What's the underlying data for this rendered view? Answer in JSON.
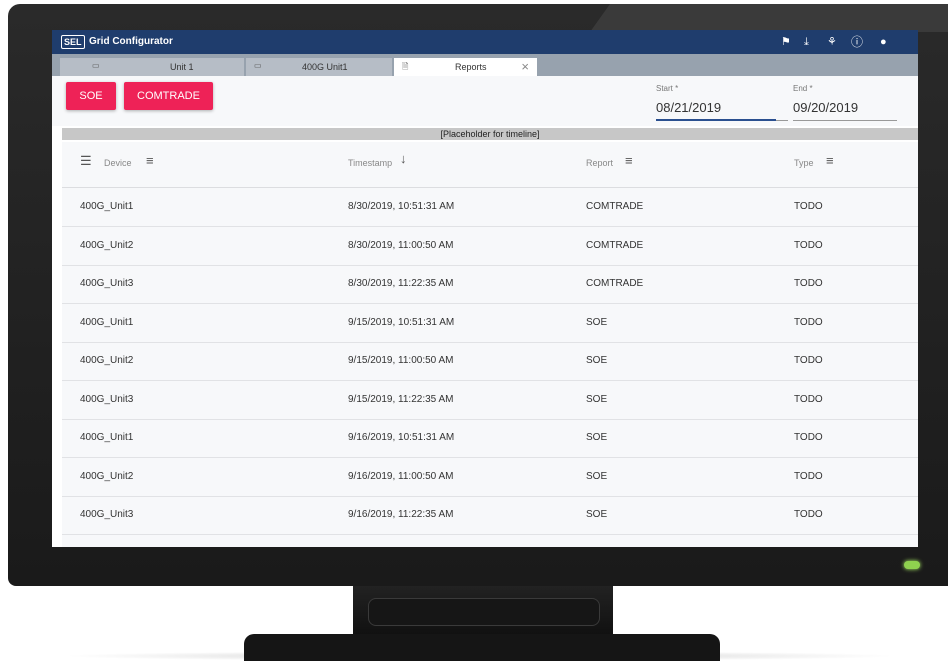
{
  "app": {
    "logo": "SEL",
    "title": "Grid Configurator"
  },
  "titlebar_icons": [
    "flag-icon",
    "download-icon",
    "network-icon",
    "help-icon",
    "user-status-icon"
  ],
  "tabs": [
    {
      "label": "Unit 1",
      "icon": "device-icon"
    },
    {
      "label": "400G Unit1",
      "icon": "device-icon"
    },
    {
      "label": "Reports",
      "icon": "document-icon",
      "active": true,
      "close": "×"
    }
  ],
  "toolbar": {
    "soe_label": "SOE",
    "comtrade_label": "COMTRADE"
  },
  "date_range": {
    "start_label": "Start *",
    "start_value": "08/21/2019",
    "end_label": "End *",
    "end_value": "09/20/2019"
  },
  "timeline": "[Placeholder for timeline]",
  "table": {
    "headers": {
      "device": "Device",
      "timestamp": "Timestamp",
      "report": "Report",
      "type": "Type"
    },
    "rows": [
      {
        "device": "400G_Unit1",
        "timestamp": "8/30/2019, 10:51:31 AM",
        "report": "COMTRADE",
        "type": "TODO"
      },
      {
        "device": "400G_Unit2",
        "timestamp": "8/30/2019, 11:00:50 AM",
        "report": "COMTRADE",
        "type": "TODO"
      },
      {
        "device": "400G_Unit3",
        "timestamp": "8/30/2019, 11:22:35 AM",
        "report": "COMTRADE",
        "type": "TODO"
      },
      {
        "device": "400G_Unit1",
        "timestamp": "9/15/2019, 10:51:31 AM",
        "report": "SOE",
        "type": "TODO"
      },
      {
        "device": "400G_Unit2",
        "timestamp": "9/15/2019, 11:00:50 AM",
        "report": "SOE",
        "type": "TODO"
      },
      {
        "device": "400G_Unit3",
        "timestamp": "9/15/2019, 11:22:35 AM",
        "report": "SOE",
        "type": "TODO"
      },
      {
        "device": "400G_Unit1",
        "timestamp": "9/16/2019, 10:51:31 AM",
        "report": "SOE",
        "type": "TODO"
      },
      {
        "device": "400G_Unit2",
        "timestamp": "9/16/2019, 11:00:50 AM",
        "report": "SOE",
        "type": "TODO"
      },
      {
        "device": "400G_Unit3",
        "timestamp": "9/16/2019, 11:22:35 AM",
        "report": "SOE",
        "type": "TODO"
      }
    ]
  },
  "colors": {
    "titlebar": "#1f3d6d",
    "accent": "#ee2257",
    "tabbar": "#97a2ae",
    "power_led": "#8fd14f"
  }
}
